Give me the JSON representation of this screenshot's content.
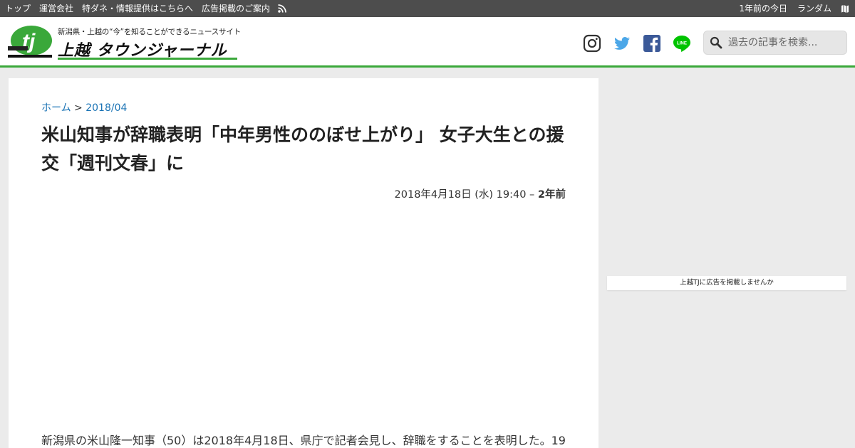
{
  "topbar": {
    "links": [
      "トップ",
      "運営会社",
      "特ダネ・情報提供はこちらへ",
      "広告掲載のご案内"
    ],
    "rss_icon": "rss-icon",
    "right_links": [
      "1年前の今日",
      "ランダム"
    ],
    "map_icon": "map-icon"
  },
  "header": {
    "logo": {
      "badge": "tj",
      "tagline": "新潟県・上越の“今”を知ることができるニュースサイト",
      "name": "上越 タウンジャーナル"
    },
    "social": [
      "instagram-icon",
      "twitter-icon",
      "facebook-icon",
      "line-icon"
    ],
    "search": {
      "placeholder": "過去の記事を検索..."
    }
  },
  "article": {
    "breadcrumb": {
      "home": "ホーム",
      "sep": ">",
      "archive": "2018/04"
    },
    "title": "米山知事が辞職表明「中年男性ののぼせ上がり」 女子大生との援交「週刊文春」に",
    "date": "2018年4月18日 (水) 19:40 –",
    "ago": "2年前",
    "body": "新潟県の米山隆一知事（50）は2018年4月18日、県庁で記者会見し、辞職をすることを表明した。19"
  },
  "sidebar": {
    "ad_text": "上越TJに広告を掲載しませんか"
  },
  "colors": {
    "topbar": "#4d4d4d",
    "accent_green": "#3aa83a",
    "link_blue": "#1a73b5",
    "twitter": "#1da1f2",
    "facebook": "#3b5998",
    "line": "#00c300"
  }
}
